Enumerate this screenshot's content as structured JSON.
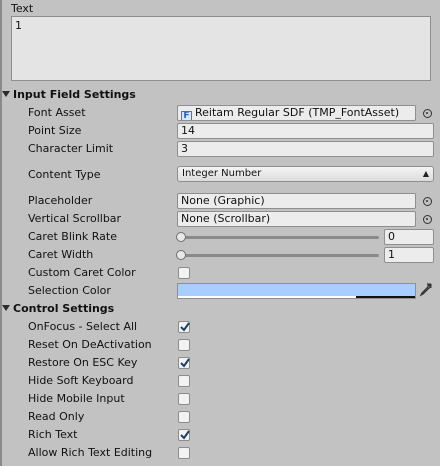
{
  "text_field": {
    "label": "Text",
    "value": "1"
  },
  "input_field_settings": {
    "header": "Input Field Settings",
    "font_asset": {
      "label": "Font Asset",
      "value": "Reitam Regular SDF (TMP_FontAsset)",
      "icon": "font-asset-icon"
    },
    "point_size": {
      "label": "Point Size",
      "value": "14"
    },
    "character_limit": {
      "label": "Character Limit",
      "value": "3"
    },
    "content_type": {
      "label": "Content Type",
      "value": "Integer Number"
    },
    "placeholder": {
      "label": "Placeholder",
      "value": "None (Graphic)"
    },
    "vertical_scrollbar": {
      "label": "Vertical Scrollbar",
      "value": "None (Scrollbar)"
    },
    "caret_blink_rate": {
      "label": "Caret Blink Rate",
      "value": "0",
      "slider_fraction": 0
    },
    "caret_width": {
      "label": "Caret Width",
      "value": "1",
      "slider_fraction": 0
    },
    "custom_caret_color": {
      "label": "Custom Caret Color",
      "checked": false
    },
    "selection_color": {
      "label": "Selection Color",
      "color": "#a8ceff",
      "alpha_fraction": 0.75
    }
  },
  "control_settings": {
    "header": "Control Settings",
    "items": [
      {
        "label": "OnFocus - Select All",
        "checked": true
      },
      {
        "label": "Reset On DeActivation",
        "checked": false
      },
      {
        "label": "Restore On ESC Key",
        "checked": true
      },
      {
        "label": "Hide Soft Keyboard",
        "checked": false
      },
      {
        "label": "Hide Mobile Input",
        "checked": false
      },
      {
        "label": "Read Only",
        "checked": false
      },
      {
        "label": "Rich Text",
        "checked": true
      },
      {
        "label": "Allow Rich Text Editing",
        "checked": false
      }
    ]
  },
  "colors": {
    "panel_bg": "#c2c2c2",
    "field_bg": "#ececec",
    "checkmark": "#1f3f66"
  }
}
